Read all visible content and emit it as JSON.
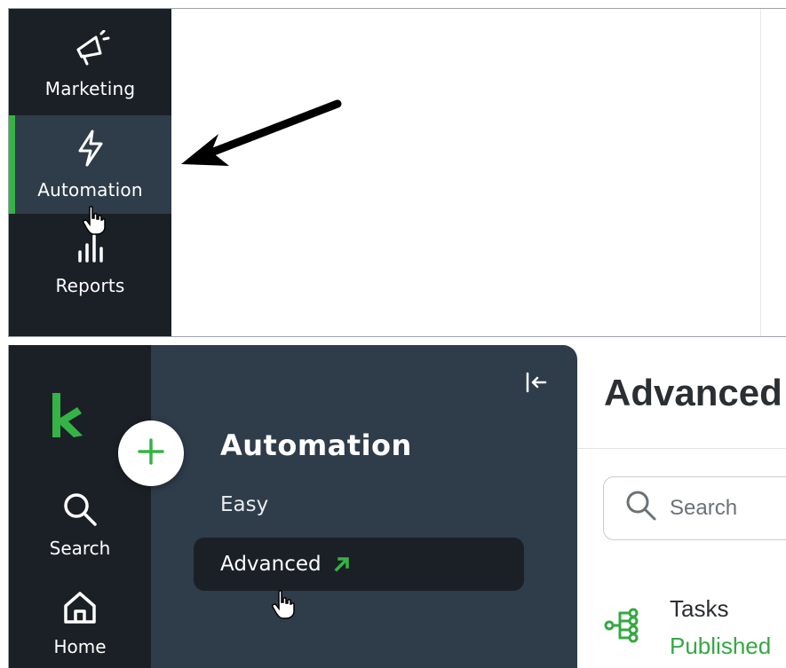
{
  "top_panel": {
    "rail_items": [
      {
        "label": "Marketing",
        "icon": "megaphone-icon"
      },
      {
        "label": "Automation",
        "icon": "lightning-bolt-icon",
        "active": true
      },
      {
        "label": "Reports",
        "icon": "bar-chart-icon"
      }
    ]
  },
  "bottom_panel": {
    "rail": {
      "logo": "keap-logo",
      "items": [
        {
          "label": "Search",
          "icon": "search-icon"
        },
        {
          "label": "Home",
          "icon": "home-icon"
        }
      ]
    },
    "flyout": {
      "title": "Automation",
      "links": [
        {
          "label": "Easy"
        },
        {
          "label": "Advanced",
          "icon": "external-arrow-icon",
          "active": true
        }
      ]
    },
    "main": {
      "page_title": "Advanced",
      "search_placeholder": "Search",
      "task": {
        "name": "Tasks",
        "status": "Published"
      }
    }
  },
  "colors": {
    "rail_dark": "#1b2027",
    "flyout_slate": "#2f3c4a",
    "accent_green": "#35b345"
  }
}
